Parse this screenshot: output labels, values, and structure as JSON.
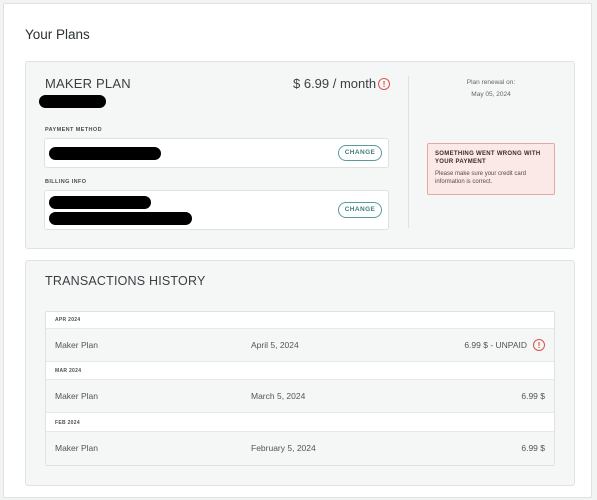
{
  "page": {
    "title": "Your Plans"
  },
  "plan": {
    "name": "MAKER PLAN",
    "price": "$ 6.99 / month",
    "warning_icon": "exclamation-circle-icon",
    "payment_method": {
      "label": "PAYMENT METHOD",
      "button": "CHANGE"
    },
    "billing_info": {
      "label": "BILLING INFO",
      "button": "CHANGE"
    },
    "renewal": {
      "label": "Plan renewal on:",
      "date": "May 05, 2024"
    },
    "alert": {
      "title": "SOMETHING WENT WRONG WITH YOUR PAYMENT",
      "message": "Please make sure your credit card information is correct."
    }
  },
  "transactions": {
    "title": "TRANSACTIONS HISTORY",
    "groups": [
      {
        "month": "APR 2024",
        "plan": "Maker Plan",
        "date": "April 5, 2024",
        "amount": "6.99 $ - UNPAID",
        "unpaid": true
      },
      {
        "month": "MAR 2024",
        "plan": "Maker Plan",
        "date": "March 5, 2024",
        "amount": "6.99 $",
        "unpaid": false
      },
      {
        "month": "FEB 2024",
        "plan": "Maker Plan",
        "date": "February 5, 2024",
        "amount": "6.99 $",
        "unpaid": false
      }
    ]
  },
  "colors": {
    "accent": "#3f7d7d",
    "error": "#d9534f",
    "alert_bg": "#fbe9e8",
    "redaction": "#000000"
  }
}
